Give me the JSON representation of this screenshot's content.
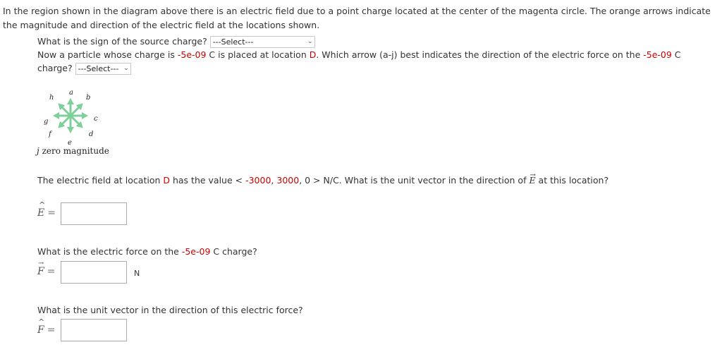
{
  "intro": {
    "p1": "In the region shown in the diagram above there is an electric field due to a point charge located at the center of the magenta circle. The orange arrows indicate the magnitude and direction of the electric field at the locations shown."
  },
  "q1": {
    "text": "What is the sign of the source charge?",
    "select_value": "---Select---"
  },
  "q2": {
    "part1": "Now a particle whose charge is ",
    "charge": "-5e-09",
    "part2": " C is placed at location ",
    "location": "D",
    "part3": ". Which arrow (a-j) best indicates the direction of the electric force on the ",
    "charge2": "-5e-09",
    "part4": " C charge?",
    "select_value": "---Select---"
  },
  "diagram": {
    "labels": {
      "a": "a",
      "b": "b",
      "c": "c",
      "d": "d",
      "e": "e",
      "f": "f",
      "g": "g",
      "h": "h"
    },
    "zero_letter": "j",
    "zero_text": "zero magnitude",
    "arrow_color": "#7fcf9a"
  },
  "q3": {
    "part1": "The electric field at location ",
    "location": "D",
    "part2": " has the value < ",
    "ex": "-3000",
    "comma1": ", ",
    "ey": "3000",
    "part3": ", 0 > N/C. What is the unit vector in the direction of ",
    "part4": " at this location?",
    "e_symbol": "E"
  },
  "answers": {
    "ehat_label": "E",
    "ehat_value": "",
    "force_label": "F",
    "force_value": "",
    "force_unit": "N",
    "fhat_label": "F",
    "fhat_value": ""
  },
  "q4": {
    "part1": "What is the electric force on the ",
    "charge": "-5e-09",
    "part2": " C charge?"
  },
  "q5": {
    "text": "What is the unit vector in the direction of this electric force?"
  }
}
